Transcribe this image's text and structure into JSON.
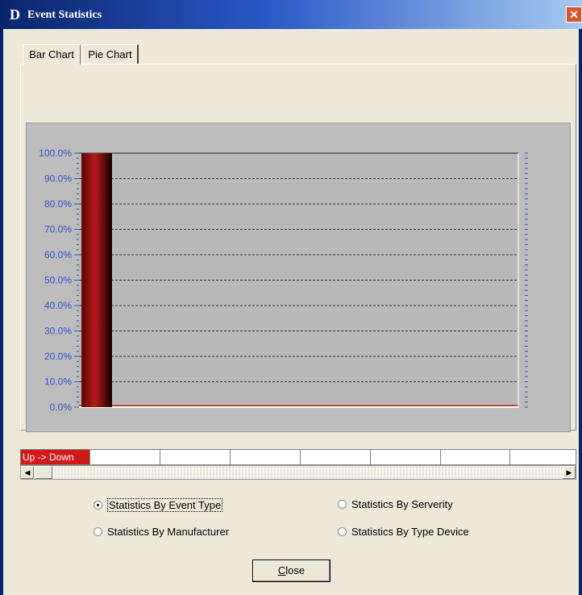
{
  "window": {
    "title": "Event Statistics",
    "logo": "D",
    "close_glyph": "✕"
  },
  "tabs": [
    {
      "label": "Bar Chart"
    },
    {
      "label": "Pie Chart"
    }
  ],
  "chart_data": {
    "type": "bar",
    "categories": [
      "Up -> Down"
    ],
    "values": [
      100.0
    ],
    "ylim": [
      0,
      100
    ],
    "yticks": [
      "0.0%",
      "10.0%",
      "20.0%",
      "30.0%",
      "40.0%",
      "50.0%",
      "60.0%",
      "70.0%",
      "80.0%",
      "90.0%",
      "100.0%"
    ],
    "grid": true,
    "bar_color": "#b51a1a",
    "title": "",
    "xlabel": "",
    "ylabel": ""
  },
  "status_strip": {
    "first_cell": "Up -> Down",
    "first_cell_color": "#d01a1a"
  },
  "radio_options": {
    "event_type": {
      "label": "Statistics By Event Type",
      "selected": true
    },
    "manufacturer": {
      "label": "Statistics By Manufacturer",
      "selected": false
    },
    "serverity": {
      "label": "Statistics By Serverity",
      "selected": false
    },
    "type_device": {
      "label": "Statistics By Type Device",
      "selected": false
    }
  },
  "buttons": {
    "close_first": "C",
    "close_rest": "lose"
  },
  "colors": {
    "titlebar": "#0a246a",
    "chart_bg": "#bdbdbd",
    "axis_label": "#2e52c8"
  }
}
